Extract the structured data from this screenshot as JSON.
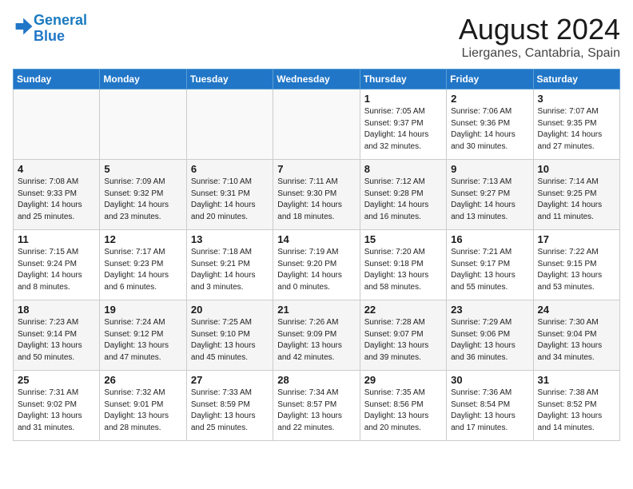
{
  "logo": {
    "line1": "General",
    "line2": "Blue"
  },
  "title": "August 2024",
  "subtitle": "Lierganes, Cantabria, Spain",
  "headers": [
    "Sunday",
    "Monday",
    "Tuesday",
    "Wednesday",
    "Thursday",
    "Friday",
    "Saturday"
  ],
  "weeks": [
    [
      {
        "day": "",
        "info": ""
      },
      {
        "day": "",
        "info": ""
      },
      {
        "day": "",
        "info": ""
      },
      {
        "day": "",
        "info": ""
      },
      {
        "day": "1",
        "info": "Sunrise: 7:05 AM\nSunset: 9:37 PM\nDaylight: 14 hours\nand 32 minutes."
      },
      {
        "day": "2",
        "info": "Sunrise: 7:06 AM\nSunset: 9:36 PM\nDaylight: 14 hours\nand 30 minutes."
      },
      {
        "day": "3",
        "info": "Sunrise: 7:07 AM\nSunset: 9:35 PM\nDaylight: 14 hours\nand 27 minutes."
      }
    ],
    [
      {
        "day": "4",
        "info": "Sunrise: 7:08 AM\nSunset: 9:33 PM\nDaylight: 14 hours\nand 25 minutes."
      },
      {
        "day": "5",
        "info": "Sunrise: 7:09 AM\nSunset: 9:32 PM\nDaylight: 14 hours\nand 23 minutes."
      },
      {
        "day": "6",
        "info": "Sunrise: 7:10 AM\nSunset: 9:31 PM\nDaylight: 14 hours\nand 20 minutes."
      },
      {
        "day": "7",
        "info": "Sunrise: 7:11 AM\nSunset: 9:30 PM\nDaylight: 14 hours\nand 18 minutes."
      },
      {
        "day": "8",
        "info": "Sunrise: 7:12 AM\nSunset: 9:28 PM\nDaylight: 14 hours\nand 16 minutes."
      },
      {
        "day": "9",
        "info": "Sunrise: 7:13 AM\nSunset: 9:27 PM\nDaylight: 14 hours\nand 13 minutes."
      },
      {
        "day": "10",
        "info": "Sunrise: 7:14 AM\nSunset: 9:25 PM\nDaylight: 14 hours\nand 11 minutes."
      }
    ],
    [
      {
        "day": "11",
        "info": "Sunrise: 7:15 AM\nSunset: 9:24 PM\nDaylight: 14 hours\nand 8 minutes."
      },
      {
        "day": "12",
        "info": "Sunrise: 7:17 AM\nSunset: 9:23 PM\nDaylight: 14 hours\nand 6 minutes."
      },
      {
        "day": "13",
        "info": "Sunrise: 7:18 AM\nSunset: 9:21 PM\nDaylight: 14 hours\nand 3 minutes."
      },
      {
        "day": "14",
        "info": "Sunrise: 7:19 AM\nSunset: 9:20 PM\nDaylight: 14 hours\nand 0 minutes."
      },
      {
        "day": "15",
        "info": "Sunrise: 7:20 AM\nSunset: 9:18 PM\nDaylight: 13 hours\nand 58 minutes."
      },
      {
        "day": "16",
        "info": "Sunrise: 7:21 AM\nSunset: 9:17 PM\nDaylight: 13 hours\nand 55 minutes."
      },
      {
        "day": "17",
        "info": "Sunrise: 7:22 AM\nSunset: 9:15 PM\nDaylight: 13 hours\nand 53 minutes."
      }
    ],
    [
      {
        "day": "18",
        "info": "Sunrise: 7:23 AM\nSunset: 9:14 PM\nDaylight: 13 hours\nand 50 minutes."
      },
      {
        "day": "19",
        "info": "Sunrise: 7:24 AM\nSunset: 9:12 PM\nDaylight: 13 hours\nand 47 minutes."
      },
      {
        "day": "20",
        "info": "Sunrise: 7:25 AM\nSunset: 9:10 PM\nDaylight: 13 hours\nand 45 minutes."
      },
      {
        "day": "21",
        "info": "Sunrise: 7:26 AM\nSunset: 9:09 PM\nDaylight: 13 hours\nand 42 minutes."
      },
      {
        "day": "22",
        "info": "Sunrise: 7:28 AM\nSunset: 9:07 PM\nDaylight: 13 hours\nand 39 minutes."
      },
      {
        "day": "23",
        "info": "Sunrise: 7:29 AM\nSunset: 9:06 PM\nDaylight: 13 hours\nand 36 minutes."
      },
      {
        "day": "24",
        "info": "Sunrise: 7:30 AM\nSunset: 9:04 PM\nDaylight: 13 hours\nand 34 minutes."
      }
    ],
    [
      {
        "day": "25",
        "info": "Sunrise: 7:31 AM\nSunset: 9:02 PM\nDaylight: 13 hours\nand 31 minutes."
      },
      {
        "day": "26",
        "info": "Sunrise: 7:32 AM\nSunset: 9:01 PM\nDaylight: 13 hours\nand 28 minutes."
      },
      {
        "day": "27",
        "info": "Sunrise: 7:33 AM\nSunset: 8:59 PM\nDaylight: 13 hours\nand 25 minutes."
      },
      {
        "day": "28",
        "info": "Sunrise: 7:34 AM\nSunset: 8:57 PM\nDaylight: 13 hours\nand 22 minutes."
      },
      {
        "day": "29",
        "info": "Sunrise: 7:35 AM\nSunset: 8:56 PM\nDaylight: 13 hours\nand 20 minutes."
      },
      {
        "day": "30",
        "info": "Sunrise: 7:36 AM\nSunset: 8:54 PM\nDaylight: 13 hours\nand 17 minutes."
      },
      {
        "day": "31",
        "info": "Sunrise: 7:38 AM\nSunset: 8:52 PM\nDaylight: 13 hours\nand 14 minutes."
      }
    ]
  ]
}
